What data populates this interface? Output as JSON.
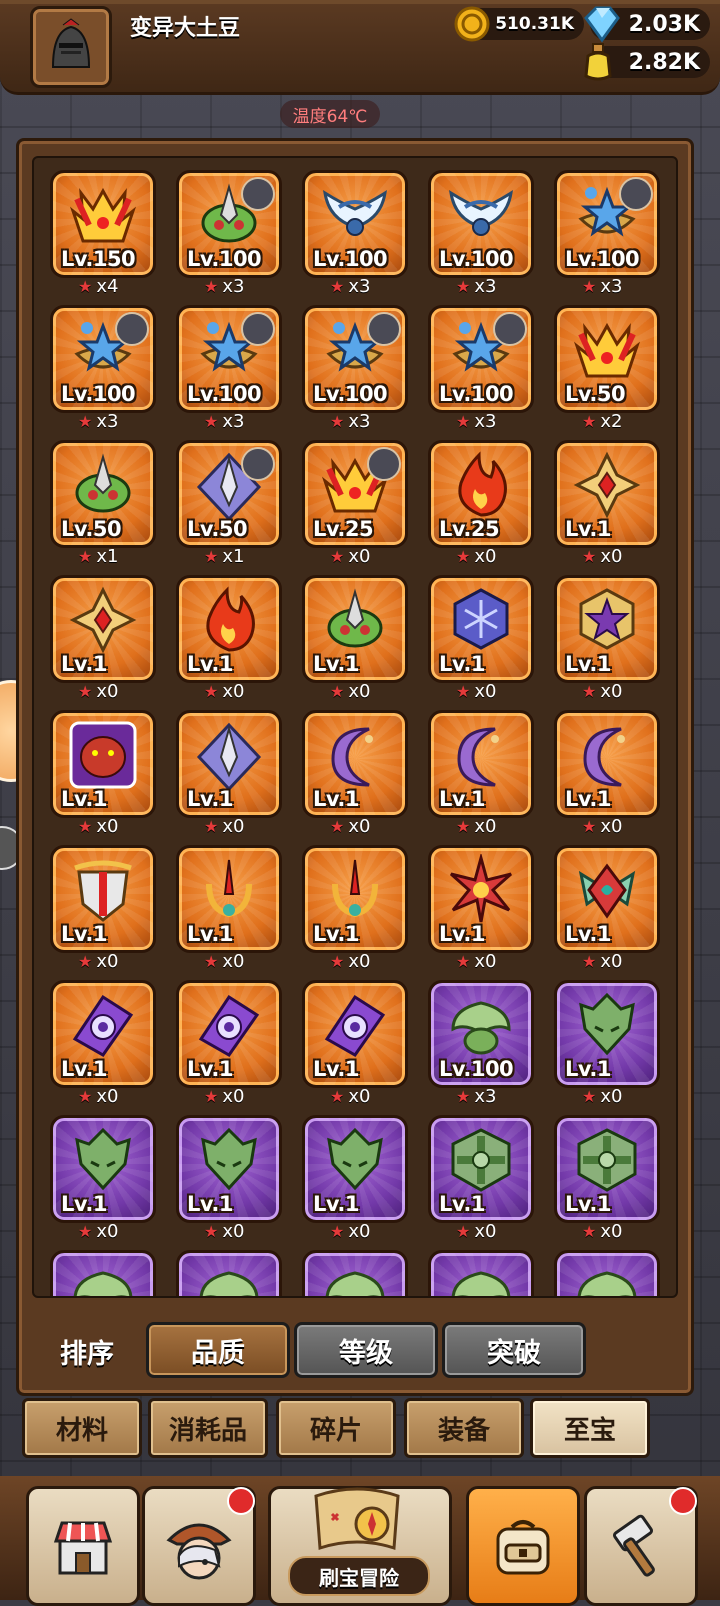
{
  "header": {
    "player_name": "变异大土豆",
    "gold": "510.31K",
    "diamond": "2.03K",
    "potion": "2.82K",
    "temperature": "温度64℃"
  },
  "colors": {
    "orange_tile": "#e0701c",
    "purple_tile": "#7339a9",
    "star": "#e53a3a"
  },
  "items": [
    {
      "lv": "Lv.150",
      "count": "x4",
      "rarity": "orange",
      "icon": "flame-crown-icon",
      "badge": false
    },
    {
      "lv": "Lv.100",
      "count": "x3",
      "rarity": "orange",
      "icon": "green-horned-mask-icon",
      "badge": true
    },
    {
      "lv": "Lv.100",
      "count": "x3",
      "rarity": "orange",
      "icon": "winged-crest-icon",
      "badge": false
    },
    {
      "lv": "Lv.100",
      "count": "x3",
      "rarity": "orange",
      "icon": "winged-crest-icon",
      "badge": false
    },
    {
      "lv": "Lv.100",
      "count": "x3",
      "rarity": "orange",
      "icon": "blue-star-amulet-icon",
      "badge": true
    },
    {
      "lv": "Lv.100",
      "count": "x3",
      "rarity": "orange",
      "icon": "blue-star-amulet-icon",
      "badge": true
    },
    {
      "lv": "Lv.100",
      "count": "x3",
      "rarity": "orange",
      "icon": "blue-star-amulet-icon",
      "badge": true
    },
    {
      "lv": "Lv.100",
      "count": "x3",
      "rarity": "orange",
      "icon": "blue-star-amulet-icon",
      "badge": true
    },
    {
      "lv": "Lv.100",
      "count": "x3",
      "rarity": "orange",
      "icon": "blue-star-amulet-icon",
      "badge": true
    },
    {
      "lv": "Lv.50",
      "count": "x2",
      "rarity": "orange",
      "icon": "flame-crown-icon",
      "badge": false
    },
    {
      "lv": "Lv.50",
      "count": "x1",
      "rarity": "orange",
      "icon": "green-horned-mask-icon",
      "badge": false
    },
    {
      "lv": "Lv.50",
      "count": "x1",
      "rarity": "orange",
      "icon": "diamond-blade-icon",
      "badge": true
    },
    {
      "lv": "Lv.25",
      "count": "x0",
      "rarity": "orange",
      "icon": "flame-crown-icon",
      "badge": true
    },
    {
      "lv": "Lv.25",
      "count": "x0",
      "rarity": "orange",
      "icon": "fire-icon",
      "badge": false
    },
    {
      "lv": "Lv.1",
      "count": "x0",
      "rarity": "orange",
      "icon": "golden-cross-icon",
      "badge": false
    },
    {
      "lv": "Lv.1",
      "count": "x0",
      "rarity": "orange",
      "icon": "golden-cross-icon",
      "badge": false
    },
    {
      "lv": "Lv.1",
      "count": "x0",
      "rarity": "orange",
      "icon": "fire-icon",
      "badge": false
    },
    {
      "lv": "Lv.1",
      "count": "x0",
      "rarity": "orange",
      "icon": "green-horned-mask-icon",
      "badge": false
    },
    {
      "lv": "Lv.1",
      "count": "x0",
      "rarity": "orange",
      "icon": "snowflake-hexagon-icon",
      "badge": false
    },
    {
      "lv": "Lv.1",
      "count": "x0",
      "rarity": "orange",
      "icon": "purple-star-emblem-icon",
      "badge": false
    },
    {
      "lv": "Lv.1",
      "count": "x0",
      "rarity": "orange",
      "icon": "red-monster-portrait-icon",
      "badge": false
    },
    {
      "lv": "Lv.1",
      "count": "x0",
      "rarity": "orange",
      "icon": "diamond-blade-icon",
      "badge": false
    },
    {
      "lv": "Lv.1",
      "count": "x0",
      "rarity": "orange",
      "icon": "crescent-moon-icon",
      "badge": false
    },
    {
      "lv": "Lv.1",
      "count": "x0",
      "rarity": "orange",
      "icon": "crescent-moon-icon",
      "badge": false
    },
    {
      "lv": "Lv.1",
      "count": "x0",
      "rarity": "orange",
      "icon": "crescent-moon-icon",
      "badge": false
    },
    {
      "lv": "Lv.1",
      "count": "x0",
      "rarity": "orange",
      "icon": "shield-sword-icon",
      "badge": false
    },
    {
      "lv": "Lv.1",
      "count": "x0",
      "rarity": "orange",
      "icon": "trident-icon",
      "badge": false
    },
    {
      "lv": "Lv.1",
      "count": "x0",
      "rarity": "orange",
      "icon": "trident-icon",
      "badge": false
    },
    {
      "lv": "Lv.1",
      "count": "x0",
      "rarity": "orange",
      "icon": "red-spiked-star-icon",
      "badge": false
    },
    {
      "lv": "Lv.1",
      "count": "x0",
      "rarity": "orange",
      "icon": "winged-emerald-icon",
      "badge": false
    },
    {
      "lv": "Lv.1",
      "count": "x0",
      "rarity": "orange",
      "icon": "purple-eye-blade-icon",
      "badge": false
    },
    {
      "lv": "Lv.1",
      "count": "x0",
      "rarity": "orange",
      "icon": "purple-eye-blade-icon",
      "badge": false
    },
    {
      "lv": "Lv.1",
      "count": "x0",
      "rarity": "orange",
      "icon": "purple-eye-blade-icon",
      "badge": false
    },
    {
      "lv": "Lv.100",
      "count": "x3",
      "rarity": "purple",
      "icon": "green-winged-helm-icon",
      "badge": false
    },
    {
      "lv": "Lv.1",
      "count": "x0",
      "rarity": "purple",
      "icon": "green-dragon-mask-icon",
      "badge": false
    },
    {
      "lv": "Lv.1",
      "count": "x0",
      "rarity": "purple",
      "icon": "green-dragon-mask-icon",
      "badge": false
    },
    {
      "lv": "Lv.1",
      "count": "x0",
      "rarity": "purple",
      "icon": "green-dragon-mask-icon",
      "badge": false
    },
    {
      "lv": "Lv.1",
      "count": "x0",
      "rarity": "purple",
      "icon": "green-dragon-mask-icon",
      "badge": false
    },
    {
      "lv": "Lv.1",
      "count": "x0",
      "rarity": "purple",
      "icon": "green-cross-shield-icon",
      "badge": false
    },
    {
      "lv": "Lv.1",
      "count": "x0",
      "rarity": "purple",
      "icon": "green-cross-shield-icon",
      "badge": false
    },
    {
      "lv": "",
      "count": "",
      "rarity": "purple",
      "icon": "green-winged-helm-icon",
      "badge": false
    },
    {
      "lv": "",
      "count": "",
      "rarity": "purple",
      "icon": "green-winged-helm-icon",
      "badge": false
    },
    {
      "lv": "",
      "count": "",
      "rarity": "purple",
      "icon": "green-winged-helm-icon",
      "badge": false
    },
    {
      "lv": "",
      "count": "",
      "rarity": "purple",
      "icon": "green-winged-helm-icon",
      "badge": false
    },
    {
      "lv": "",
      "count": "",
      "rarity": "purple",
      "icon": "green-winged-helm-icon",
      "badge": false
    }
  ],
  "sort": {
    "label": "排序",
    "buttons": [
      "品质",
      "等级",
      "突破"
    ],
    "active": 0
  },
  "categories": {
    "tabs": [
      "材料",
      "消耗品",
      "碎片",
      "装备",
      "至宝"
    ],
    "active": 4
  },
  "bottom_nav": {
    "adventure_label": "刷宝冒险"
  }
}
